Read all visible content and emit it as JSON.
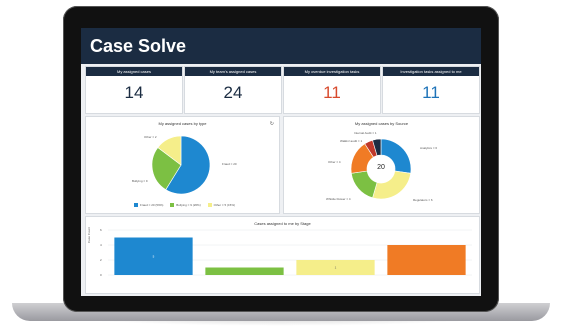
{
  "app": {
    "title": "Case Solve"
  },
  "kpis": [
    {
      "label": "My assigned cases",
      "value": "14",
      "color": "#1b2c42"
    },
    {
      "label": "My team's assigned cases",
      "value": "24",
      "color": "#1b2c42"
    },
    {
      "label": "My overdue investigation tasks",
      "value": "11",
      "color": "#d84a2d"
    },
    {
      "label": "Investigation tasks assigned to me",
      "value": "11",
      "color": "#1e73b8"
    }
  ],
  "panels": {
    "by_type": {
      "title": "My assigned cases by type",
      "labels": {
        "other": "Other = 2",
        "fraud": "Fraud = 20",
        "bullying": "Bullying = 9"
      },
      "legend": [
        "Fraud = 20 (59%)",
        "Bullying = 9 (26%)",
        "Other = 5 (15%)"
      ]
    },
    "by_source": {
      "title": "My assigned cases by Source",
      "center": "20",
      "labels": {
        "internal_audit": "Internal Audit = 1",
        "walk_in": "Walkin/ audit = 1",
        "other": "Other = 4",
        "whistle": "Whistle blower = 4",
        "analytics": "Analytics = 6",
        "regulators": "Regulators = 6"
      }
    },
    "by_stage": {
      "title": "Cases assigned to me by Stage",
      "ylabel": "Case Count",
      "yticks": [
        "6",
        "4",
        "2",
        "0"
      ]
    }
  },
  "chart_data": [
    {
      "type": "pie",
      "title": "My assigned cases by type",
      "categories": [
        "Fraud",
        "Bullying",
        "Other"
      ],
      "values": [
        20,
        9,
        5
      ],
      "colors": [
        "#1e88d0",
        "#7cc043",
        "#f5ee8a"
      ]
    },
    {
      "type": "pie",
      "title": "My assigned cases by Source",
      "categories": [
        "Analytics",
        "Regulators",
        "Whistle blower",
        "Other",
        "Walkin/ audit",
        "Internal Audit"
      ],
      "values": [
        6,
        6,
        4,
        4,
        1,
        1
      ],
      "colors": [
        "#1e88d0",
        "#f5ee8a",
        "#7cc043",
        "#f07b25",
        "#c0392b",
        "#1b2c42"
      ]
    },
    {
      "type": "bar",
      "title": "Cases assigned to me by Stage",
      "ylabel": "Case Count",
      "ylim": [
        0,
        6
      ],
      "values": [
        5,
        1,
        2,
        4
      ],
      "value_labels": [
        "5",
        "",
        "1",
        ""
      ],
      "colors": [
        "#1e88d0",
        "#7cc043",
        "#f5ee8a",
        "#f07b25"
      ]
    }
  ]
}
